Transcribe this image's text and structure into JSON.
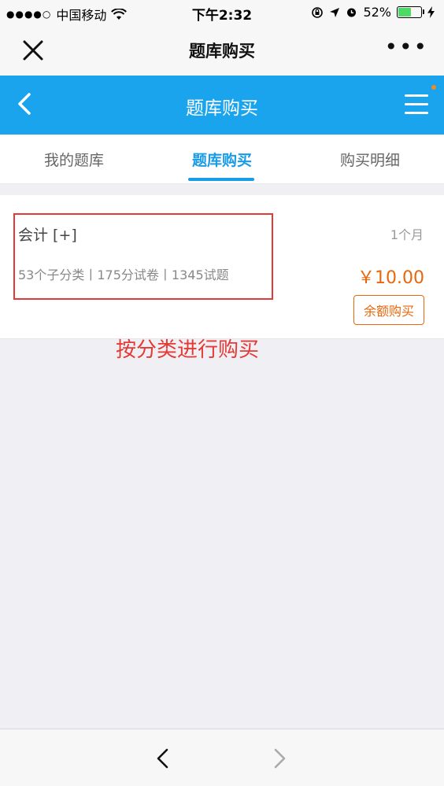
{
  "status_bar": {
    "signal": "●●●●○",
    "carrier": "中国移动",
    "time": "下午2:32",
    "battery": "52%",
    "battery_level": 0.52
  },
  "wechat_nav": {
    "title": "题库购买"
  },
  "app_header": {
    "title": "题库购买"
  },
  "tabs": [
    {
      "label": "我的题库",
      "active": false
    },
    {
      "label": "题库购买",
      "active": true
    },
    {
      "label": "购买明细",
      "active": false
    }
  ],
  "subject_card": {
    "name": "会计 [+]",
    "meta": "53个子分类丨175分试卷丨1345试题",
    "duration": "1个月",
    "price": "￥10.00",
    "buy_label": "余额购买"
  },
  "annotation": "按分类进行购买",
  "colors": {
    "header_blue": "#1aa4ee",
    "tab_active": "#1a9be6",
    "price_orange": "#e8660c",
    "annotation_red": "#e53935"
  }
}
